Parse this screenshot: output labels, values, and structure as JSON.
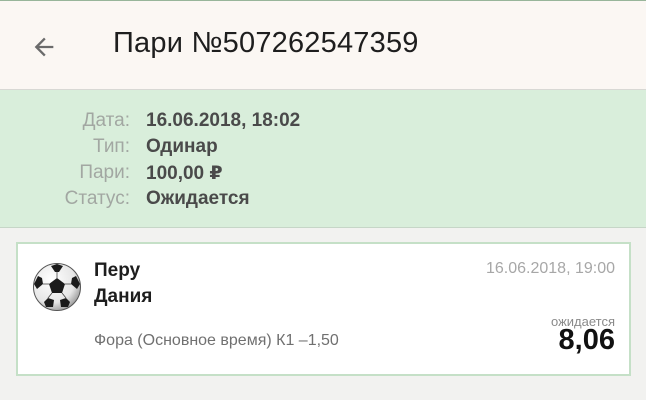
{
  "header": {
    "title": "Пари №507262547359",
    "back_icon": "arrow-left-icon"
  },
  "details": {
    "rows": [
      {
        "label": "Дата:",
        "value": "16.06.2018, 18:02"
      },
      {
        "label": "Тип:",
        "value": "Одинар"
      },
      {
        "label": "Пари:",
        "value": "100,00 ₽"
      },
      {
        "label": "Статус:",
        "value": "Ожидается"
      }
    ]
  },
  "event": {
    "sport_icon": "soccer-ball-icon",
    "team1": "Перу",
    "team2": "Дания",
    "date": "16.06.2018, 19:00",
    "market": "Фора (Основное время) К1 –1,50",
    "status": "ожидается",
    "odds": "8,06"
  },
  "colors": {
    "header_bg": "#fbf7f3",
    "info_bg": "#d9eedb",
    "card_border": "#c5e0c7",
    "page_bg": "#f2f2f0"
  }
}
